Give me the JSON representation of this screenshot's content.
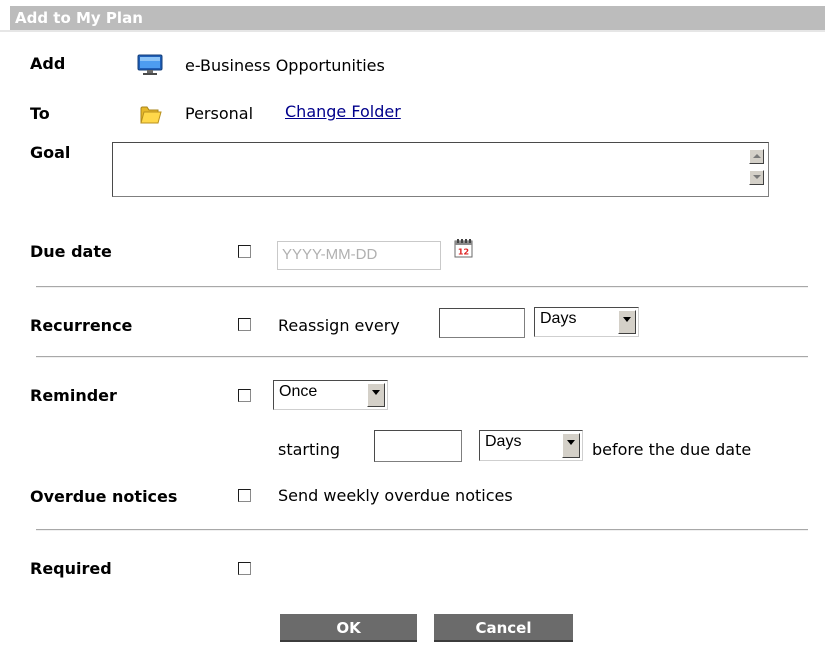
{
  "dialog": {
    "title": "Add to My Plan"
  },
  "add": {
    "label": "Add",
    "item_name": "e-Business Opportunities",
    "icon": "monitor-icon"
  },
  "to": {
    "label": "To",
    "folder_name": "Personal",
    "change_link": "Change Folder",
    "icon": "folder-icon"
  },
  "goal": {
    "label": "Goal",
    "value": ""
  },
  "due_date": {
    "label": "Due date",
    "checked": false,
    "placeholder": "YYYY-MM-DD",
    "icon": "calendar-icon",
    "calendar_day": "12"
  },
  "recurrence": {
    "label": "Recurrence",
    "checked": false,
    "text": "Reassign every",
    "interval_value": "",
    "unit_selected": "Days"
  },
  "reminder": {
    "label": "Reminder",
    "checked": false,
    "frequency_selected": "Once",
    "starting_label": "starting",
    "offset_value": "",
    "unit_selected": "Days",
    "suffix": "before the due date"
  },
  "overdue": {
    "label": "Overdue notices",
    "checked": false,
    "text": "Send weekly overdue notices"
  },
  "required": {
    "label": "Required",
    "checked": false
  },
  "buttons": {
    "ok": "OK",
    "cancel": "Cancel"
  },
  "colors": {
    "title_bar": "#bcbcbc",
    "button_bg": "#6b6b6b",
    "link": "#00008b"
  }
}
